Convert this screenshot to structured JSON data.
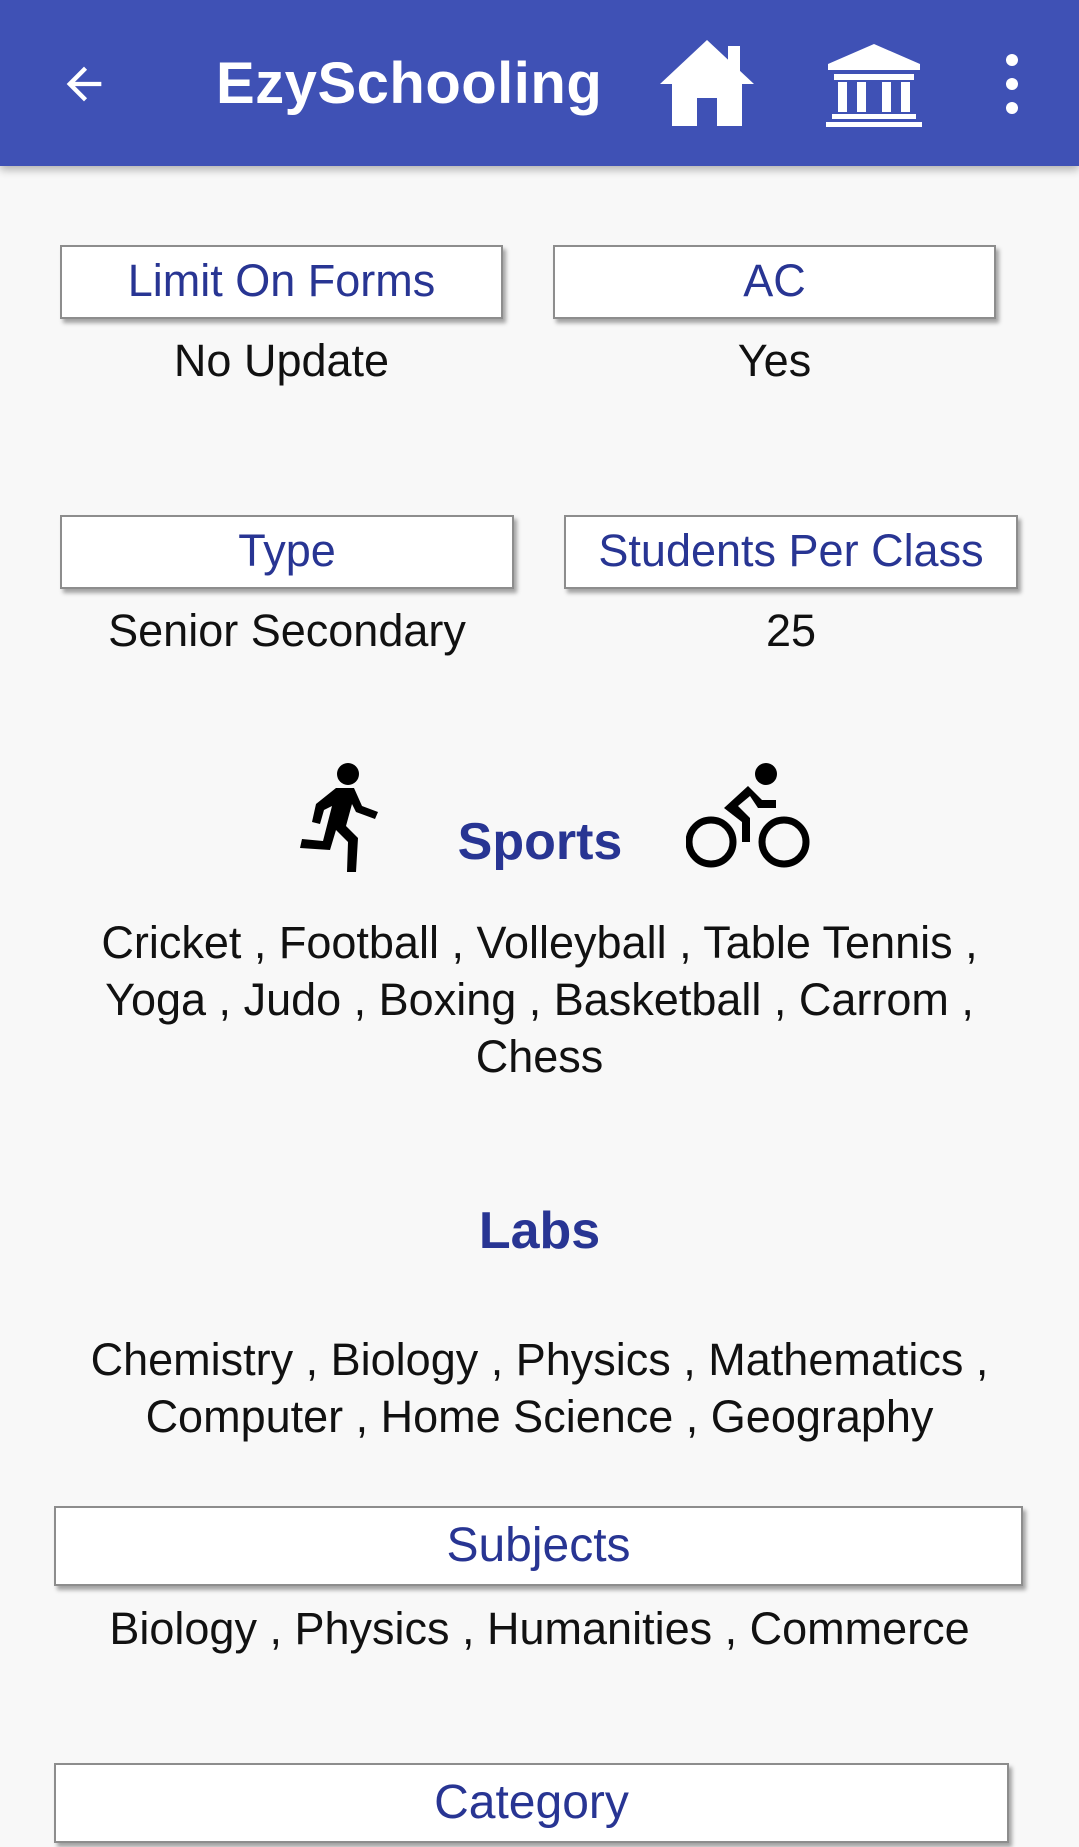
{
  "app_bar": {
    "title": "EzySchooling",
    "background_color": "#3f51b5",
    "icons": [
      "back-arrow-icon",
      "home-icon",
      "institution-icon",
      "more-vert-icon"
    ]
  },
  "fields": {
    "limit_on_forms": {
      "label": "Limit On Forms",
      "value": "No Update"
    },
    "ac": {
      "label": "AC",
      "value": "Yes"
    },
    "type": {
      "label": "Type",
      "value": "Senior Secondary"
    },
    "students_per_class": {
      "label": "Students Per Class",
      "value": "25"
    }
  },
  "sports": {
    "heading": "Sports",
    "icons": [
      "running-icon",
      "cycling-icon"
    ],
    "line1": "Cricket , Football , Volleyball , Table Tennis ,",
    "line2": "Yoga , Judo , Boxing , Basketball , Carrom ,",
    "line3": "Chess"
  },
  "labs": {
    "heading": "Labs",
    "line1": "Chemistry , Biology , Physics , Mathematics ,",
    "line2": "Computer , Home Science , Geography"
  },
  "subjects": {
    "label": "Subjects",
    "value": "Biology , Physics , Humanities , Commerce"
  },
  "category": {
    "label": "Category"
  },
  "colors": {
    "accent_text": "#283593",
    "body_text": "#111111",
    "background": "#f8f8f8"
  }
}
